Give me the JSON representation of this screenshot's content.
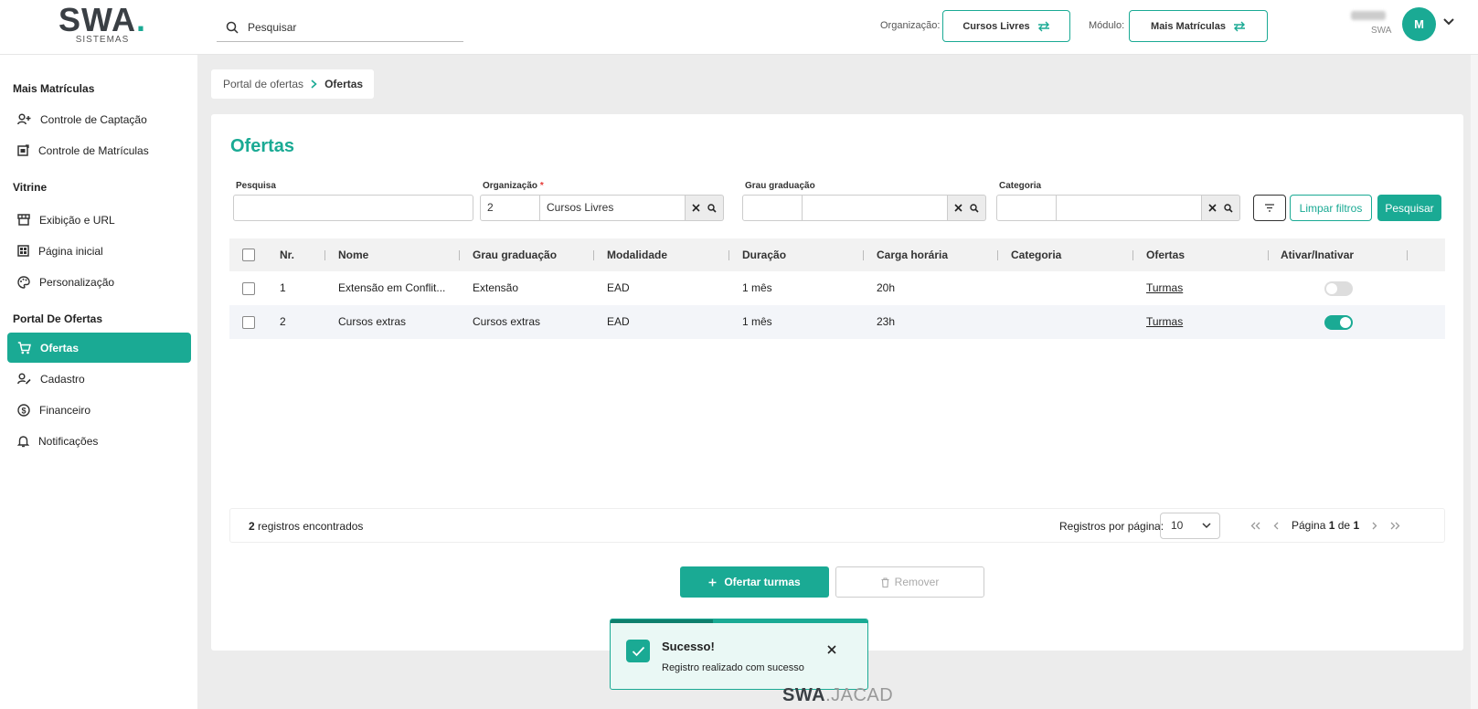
{
  "brand": {
    "logo_main": "SWA",
    "logo_dot": ".",
    "logo_sub": "SISTEMAS",
    "accent": "#1aaa94"
  },
  "header": {
    "search_placeholder": "Pesquisar",
    "org_label": "Organização:",
    "org_value": "Cursos Livres",
    "module_label": "Módulo:",
    "module_value": "Mais Matrículas",
    "user_org": "SWA",
    "avatar_initial": "M"
  },
  "sidebar": {
    "sections": [
      {
        "title": "Mais Matrículas",
        "items": [
          {
            "label": "Controle de Captação",
            "icon": "user-add-icon"
          },
          {
            "label": "Controle de Matrículas",
            "icon": "enrollment-icon"
          }
        ]
      },
      {
        "title": "Vitrine",
        "items": [
          {
            "label": "Exibição e URL",
            "icon": "storefront-icon"
          },
          {
            "label": "Página inicial",
            "icon": "grid-icon"
          },
          {
            "label": "Personalização",
            "icon": "palette-icon"
          }
        ]
      },
      {
        "title": "Portal De Ofertas",
        "items": [
          {
            "label": "Ofertas",
            "icon": "cart-icon",
            "active": true
          },
          {
            "label": "Cadastro",
            "icon": "user-edit-icon"
          },
          {
            "label": "Financeiro",
            "icon": "dollar-icon"
          },
          {
            "label": "Notificações",
            "icon": "bell-icon"
          }
        ]
      }
    ]
  },
  "breadcrumb": {
    "parent": "Portal de ofertas",
    "current": "Ofertas"
  },
  "page": {
    "title": "Ofertas"
  },
  "filters": {
    "search_label": "Pesquisa",
    "search_value": "",
    "org_label": "Organização",
    "org_required": "*",
    "org_code": "2",
    "org_name": "Cursos Livres",
    "grade_label": "Grau graduação",
    "category_label": "Categoria",
    "clear_label": "Limpar filtros",
    "search_button": "Pesquisar"
  },
  "table": {
    "columns": [
      "Nr.",
      "Nome",
      "Grau graduação",
      "Modalidade",
      "Duração",
      "Carga horária",
      "Categoria",
      "Ofertas",
      "Ativar/Inativar"
    ],
    "rows": [
      {
        "nr": "1",
        "nome": "Extensão em Conflit...",
        "grau": "Extensão",
        "modalidade": "EAD",
        "duracao": "1 mês",
        "carga": "20h",
        "categoria": "",
        "ofertas": "Turmas",
        "ativo": false
      },
      {
        "nr": "2",
        "nome": "Cursos extras",
        "grau": "Cursos extras",
        "modalidade": "EAD",
        "duracao": "1 mês",
        "carga": "23h",
        "categoria": "",
        "ofertas": "Turmas",
        "ativo": true
      }
    ]
  },
  "pagination": {
    "found_count": "2",
    "found_text": "registros encontrados",
    "per_page_label": "Registros por página:",
    "per_page_value": "10",
    "page_prefix": "Página",
    "page_current": "1",
    "page_of": "de",
    "page_total": "1"
  },
  "actions": {
    "offer_label": "Ofertar turmas",
    "remove_label": "Remover"
  },
  "toast": {
    "title": "Sucesso!",
    "message": "Registro realizado com sucesso",
    "progress": 0.4
  },
  "footer": {
    "logo_bold": "SWA",
    "logo_thin": ".JACAD"
  }
}
